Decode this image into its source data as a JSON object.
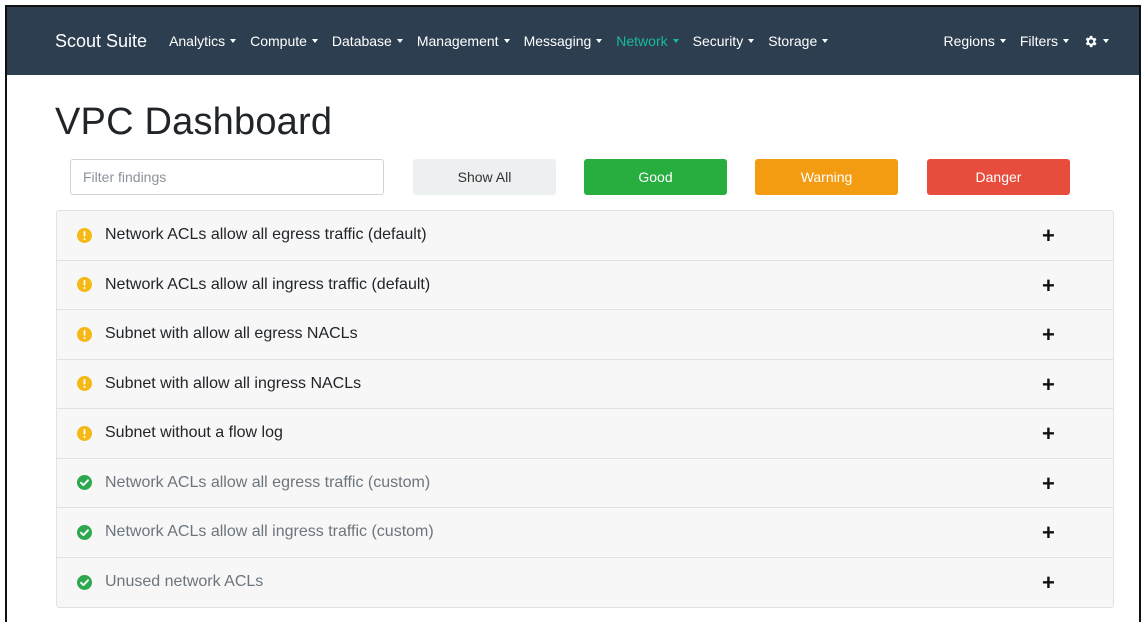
{
  "navbar": {
    "brand": "Scout Suite",
    "items": [
      {
        "label": "Analytics",
        "active": false
      },
      {
        "label": "Compute",
        "active": false
      },
      {
        "label": "Database",
        "active": false
      },
      {
        "label": "Management",
        "active": false
      },
      {
        "label": "Messaging",
        "active": false
      },
      {
        "label": "Network",
        "active": true
      },
      {
        "label": "Security",
        "active": false
      },
      {
        "label": "Storage",
        "active": false
      }
    ],
    "right_items": [
      {
        "label": "Regions"
      },
      {
        "label": "Filters"
      }
    ],
    "settings_icon": "gear-icon"
  },
  "page": {
    "title": "VPC Dashboard"
  },
  "filter": {
    "placeholder": "Filter findings"
  },
  "buttons": {
    "show_all": "Show All",
    "good": "Good",
    "warning": "Warning",
    "danger": "Danger"
  },
  "findings": [
    {
      "label": "Network ACLs allow all egress traffic (default)",
      "status": "warning",
      "expand": "+"
    },
    {
      "label": "Network ACLs allow all ingress traffic (default)",
      "status": "warning",
      "expand": "+"
    },
    {
      "label": "Subnet with allow all egress NACLs",
      "status": "warning",
      "expand": "+"
    },
    {
      "label": "Subnet with allow all ingress NACLs",
      "status": "warning",
      "expand": "+"
    },
    {
      "label": "Subnet without a flow log",
      "status": "warning",
      "expand": "+"
    },
    {
      "label": "Network ACLs allow all egress traffic (custom)",
      "status": "good",
      "expand": "+"
    },
    {
      "label": "Network ACLs allow all ingress traffic (custom)",
      "status": "good",
      "expand": "+"
    },
    {
      "label": "Unused network ACLs",
      "status": "good",
      "expand": "+"
    }
  ],
  "colors": {
    "navbar_bg": "#2c3e50",
    "active_nav": "#18bc9c",
    "good": "#27ae3e",
    "warning": "#f39c12",
    "danger": "#e74c3c"
  }
}
